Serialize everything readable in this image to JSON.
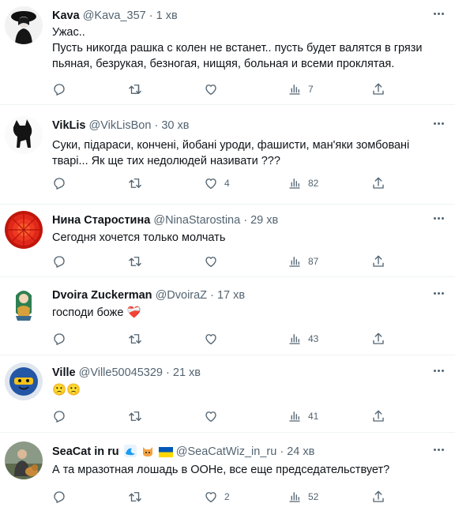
{
  "tweets": [
    {
      "name": "Kava",
      "handle": "@Kava_357",
      "dot": "·",
      "time": "1 хв",
      "lines": [
        "Ужас..",
        "Пусть никогда рашка с колен не встанет.. пусть будет валятся в грязи",
        "пьяная, безрукая, безногая, нищяя, больная и всеми проклятая."
      ],
      "likes": "",
      "views": "7"
    },
    {
      "name": "VikLis",
      "handle": "@VikLisBon",
      "dot": "·",
      "time": "30 хв",
      "lines": [
        "Суки,  підараси, кончені, йобані уроди, фашисти, ман'яки зомбовані",
        "тварі... Як ще тих недолюдей називати ???"
      ],
      "likes": "4",
      "views": "82"
    },
    {
      "name": "Нина Старостина",
      "handle": "@NinaStarostina",
      "dot": "·",
      "time": "29 хв",
      "lines": [
        "Сегодня хочется только молчать"
      ],
      "likes": "",
      "views": "87"
    },
    {
      "name": "Dvoira Zuckerman",
      "handle": "@DvoiraZ",
      "dot": "·",
      "time": "17 хв",
      "lines": [
        "господи боже ❤️‍🩹"
      ],
      "likes": "",
      "views": "43"
    },
    {
      "name": "Ville",
      "handle": "@Ville50045329",
      "dot": "·",
      "time": "21 хв",
      "lines": [
        "🙁🙁"
      ],
      "likes": "",
      "views": "41"
    },
    {
      "name": "SeaCat in ru",
      "handle": "@SeaCatWiz_in_ru",
      "dot": "·",
      "time": "24 хв",
      "lines": [
        "А та мразотная лошадь в ООНе, все еще председательствует?"
      ],
      "likes": "2",
      "views": "52"
    }
  ],
  "icons": {
    "reply": "reply-icon",
    "retweet": "retweet-icon",
    "like": "heart-icon",
    "views": "views-icon",
    "share": "share-icon",
    "more": "more-icon"
  },
  "colors": {
    "text": "#0f1419",
    "muted": "#536471",
    "divider": "#eff3f4",
    "flag_blue": "#0057b7",
    "flag_yellow": "#ffd700",
    "wave": "#1d9bf0",
    "cat": "#f4a340"
  }
}
